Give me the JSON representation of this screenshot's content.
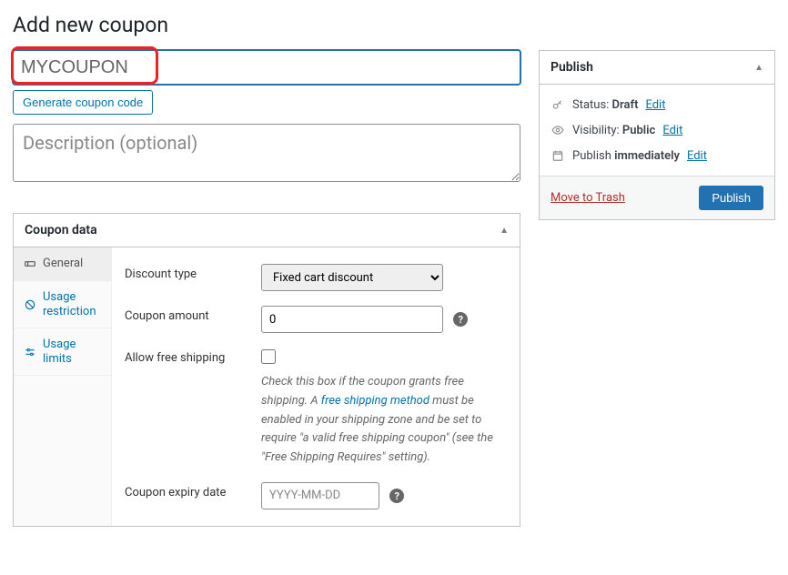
{
  "page_title": "Add new coupon",
  "coupon_code_value": "MYCOUPON",
  "generate_label": "Generate coupon code",
  "description_placeholder": "Description (optional)",
  "coupon_data": {
    "title": "Coupon data",
    "tabs": {
      "general": "General",
      "usage_restriction": "Usage restriction",
      "usage_limits": "Usage limits"
    },
    "fields": {
      "discount_type": {
        "label": "Discount type",
        "value": "Fixed cart discount"
      },
      "coupon_amount": {
        "label": "Coupon amount",
        "value": "0"
      },
      "free_shipping": {
        "label": "Allow free shipping",
        "hint_pre": "Check this box if the coupon grants free shipping. A ",
        "hint_link": "free shipping method",
        "hint_post": " must be enabled in your shipping zone and be set to require \"a valid free shipping coupon\" (see the \"Free Shipping Requires\" setting)."
      },
      "expiry": {
        "label": "Coupon expiry date",
        "placeholder": "YYYY-MM-DD"
      }
    }
  },
  "publish": {
    "title": "Publish",
    "status_label": "Status: ",
    "status_value": "Draft",
    "visibility_label": "Visibility: ",
    "visibility_value": "Public",
    "publish_label": "Publish ",
    "publish_value": "immediately",
    "edit_link": "Edit",
    "trash": "Move to Trash",
    "button": "Publish"
  }
}
